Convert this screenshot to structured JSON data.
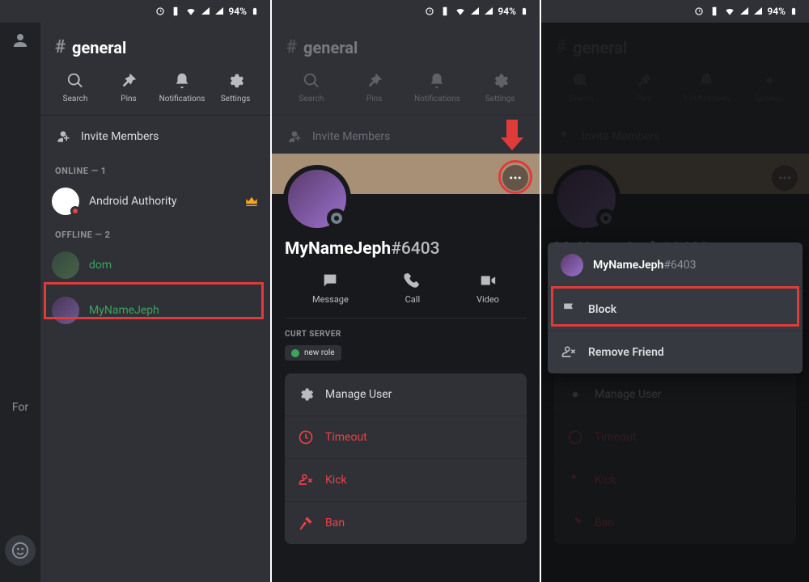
{
  "status": {
    "battery_pct": "94%"
  },
  "channel": {
    "name": "general"
  },
  "toolbar": {
    "search": "Search",
    "pins": "Pins",
    "notifications": "Notifications",
    "settings": "Settings"
  },
  "invite_label": "Invite Members",
  "sections": {
    "online": "ONLINE — 1",
    "offline": "OFFLINE — 2"
  },
  "members": {
    "aa": "Android Authority",
    "dom": "dom",
    "jeph": "MyNameJeph"
  },
  "left_rail": {
    "for_text": "For"
  },
  "profile": {
    "username": "MyNameJeph",
    "discriminator": "#6403",
    "actions": {
      "message": "Message",
      "call": "Call",
      "video": "Video"
    },
    "server_label": "CURT SERVER",
    "role": "new role",
    "mgmt": {
      "manage": "Manage User",
      "timeout": "Timeout",
      "kick": "Kick",
      "ban": "Ban"
    }
  },
  "popup": {
    "block": "Block",
    "remove_friend": "Remove Friend"
  }
}
